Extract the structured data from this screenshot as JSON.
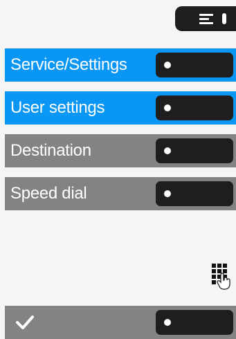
{
  "menu": {
    "icon": "menu-icon"
  },
  "items": [
    {
      "label": "Service/Settings",
      "color": "#0a96f5",
      "icon": "dot-icon"
    },
    {
      "label": "User settings",
      "color": "#0a96f5",
      "icon": "dot-icon"
    },
    {
      "label": "Destination",
      "color": "#838383",
      "icon": "dot-icon"
    },
    {
      "label": "Speed dial",
      "color": "#838383",
      "icon": "dot-icon"
    }
  ],
  "keypad": {
    "icon": "keypad-touch-icon"
  },
  "footer": {
    "icon": "checkmark-icon",
    "color": "#838383"
  }
}
